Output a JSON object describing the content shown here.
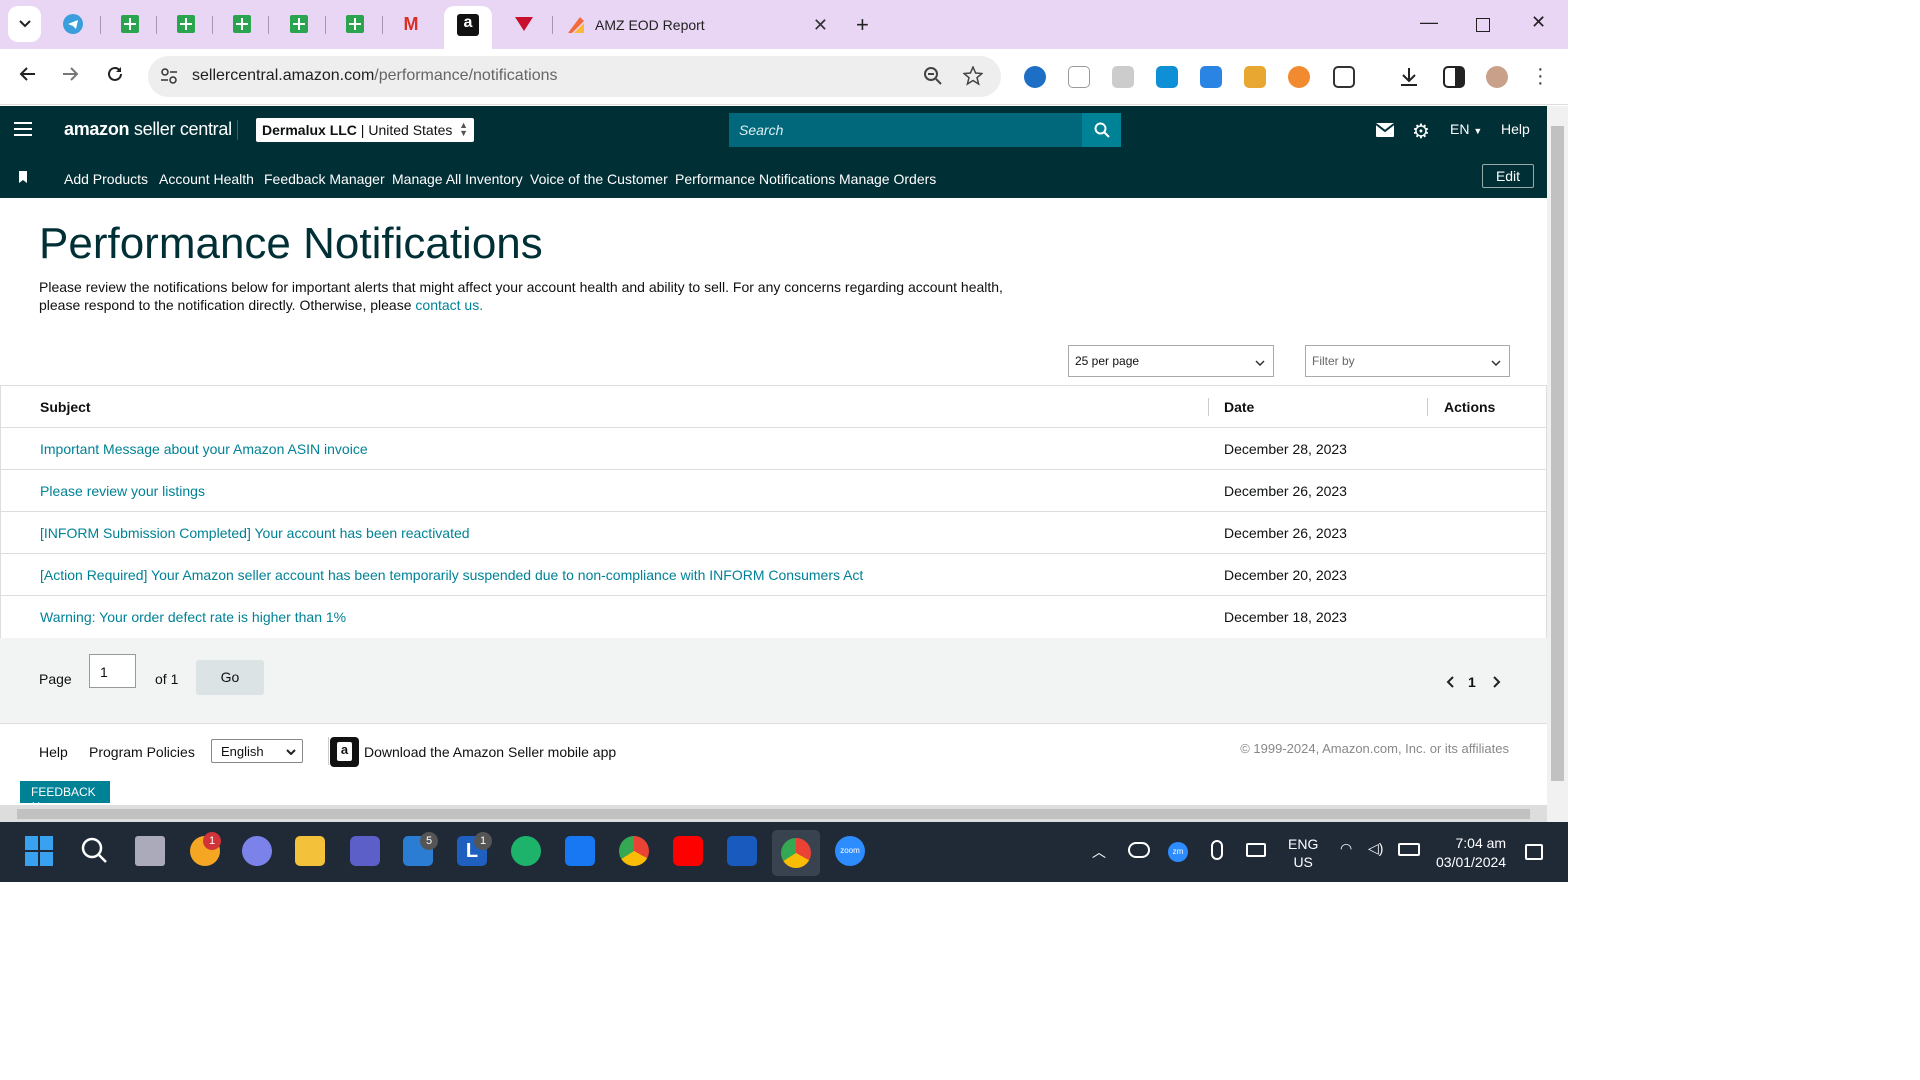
{
  "browser": {
    "tab_title": "AMZ EOD Report",
    "url_host": "sellercentral.amazon.com",
    "url_path": "/performance/notifications",
    "gmail_label": "M",
    "amazon_label": "a"
  },
  "header": {
    "logo_main": "amazon",
    "logo_sub": "seller central",
    "account_name": "Dermalux LLC",
    "account_region": "United States",
    "search_placeholder": "Search",
    "language": "EN",
    "help": "Help"
  },
  "nav": {
    "items": [
      "Add Products",
      "Account Health",
      "Feedback Manager",
      "Manage All Inventory",
      "Voice of the Customer",
      "Performance Notifications",
      "Manage Orders"
    ],
    "edit": "Edit"
  },
  "page": {
    "title": "Performance Notifications",
    "intro": "Please review the notifications below for important alerts that might affect your account health and ability to sell. For any concerns regarding account health, please respond to the notification directly. Otherwise, please ",
    "contact_link": "contact us."
  },
  "filters": {
    "per_page": "25 per page",
    "filter_by": "Filter by"
  },
  "table": {
    "headers": {
      "subject": "Subject",
      "date": "Date",
      "actions": "Actions"
    },
    "rows": [
      {
        "subject": "Important Message about your Amazon ASIN invoice",
        "date": "December 28, 2023"
      },
      {
        "subject": "Please review your listings",
        "date": "December 26, 2023"
      },
      {
        "subject": "[INFORM Submission Completed] Your account has been reactivated",
        "date": "December 26, 2023"
      },
      {
        "subject": "[Action Required] Your Amazon seller account has been temporarily suspended due to non-compliance with INFORM Consumers Act",
        "date": "December 20, 2023"
      },
      {
        "subject": "Warning: Your order defect rate is higher than 1%",
        "date": "December 18, 2023"
      }
    ]
  },
  "pager": {
    "page_label": "Page",
    "page_value": "1",
    "of_label": "of 1",
    "go": "Go",
    "current": "1"
  },
  "footer": {
    "help": "Help",
    "policies": "Program Policies",
    "language": "English",
    "app_link": "Download the Amazon Seller mobile app",
    "copyright": "© 1999-2024, Amazon.com, Inc. or its affiliates",
    "feedback": "FEEDBACK"
  },
  "taskbar": {
    "badge_notif": "1",
    "badge_mail": "5",
    "badge_l": "1",
    "l_label": "L",
    "zoom_label": "zoom",
    "zm_label": "zm",
    "lang": "ENG",
    "region": "US",
    "time": "7:04 am",
    "date": "03/01/2024"
  },
  "colors": {
    "accent": "#008296",
    "header": "#002f36",
    "tabbar": "#e9d6f5"
  }
}
